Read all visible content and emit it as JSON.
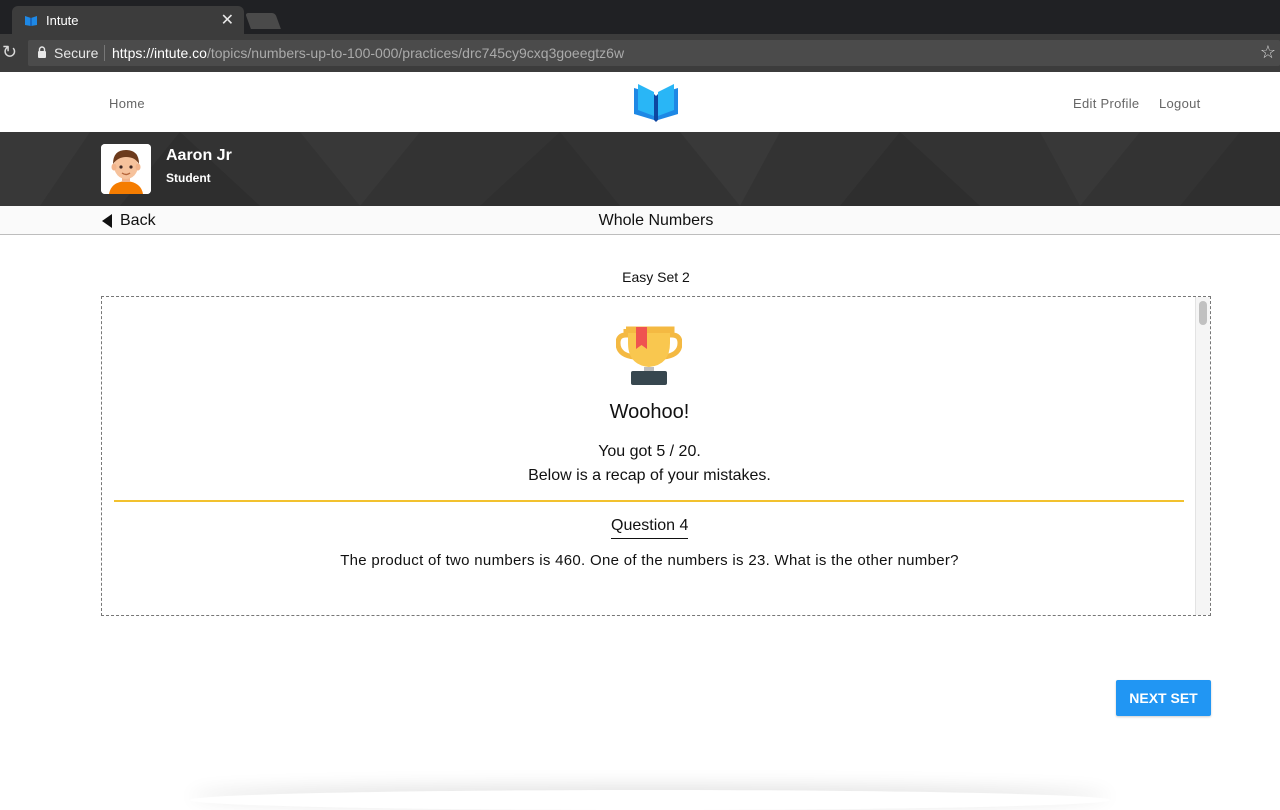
{
  "browser": {
    "tab_title": "Intute",
    "tab_close": "✕",
    "secure_label": "Secure",
    "url_host": "https://intute.co",
    "url_path": "/topics/numbers-up-to-100-000/practices/drc745cy9cxq3goeegtz6w"
  },
  "nav": {
    "home": "Home",
    "edit_profile": "Edit Profile",
    "logout": "Logout",
    "logo_icon": "open-book-logo"
  },
  "profile": {
    "name": "Aaron Jr",
    "role": "Student"
  },
  "subheader": {
    "back": "Back",
    "title": "Whole Numbers"
  },
  "practice": {
    "set_label": "Easy Set 2",
    "headline": "Woohoo!",
    "score_text": "You got 5 / 20.",
    "recap_text": "Below is a recap of your mistakes.",
    "question_heading": "Question 4",
    "question_text": "The product of two numbers is 460. One of the numbers is 23. What is the other number?"
  },
  "actions": {
    "next_set": "NEXT SET"
  },
  "colors": {
    "accent_blue": "#2196f3",
    "divider_yellow": "#f2c12e",
    "banner_dark": "#333333"
  }
}
